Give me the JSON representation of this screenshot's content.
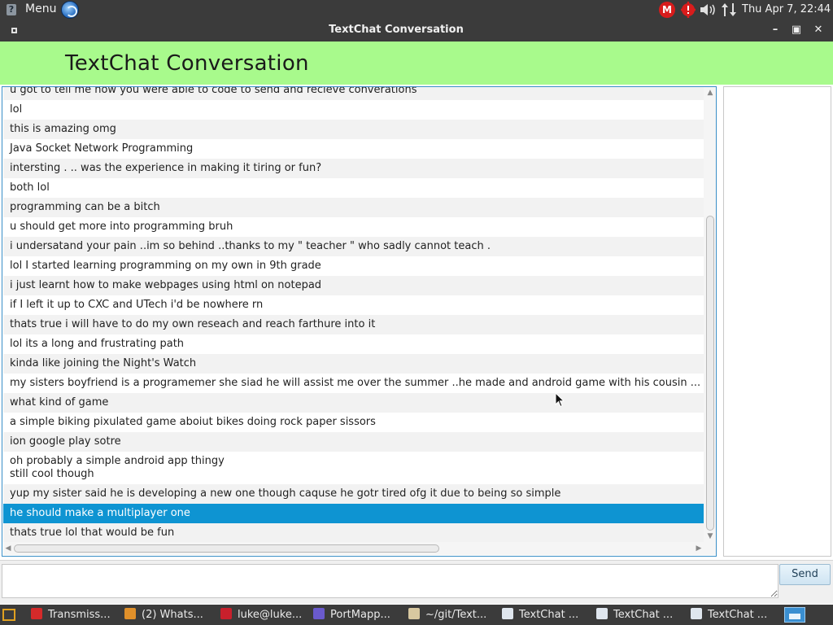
{
  "top_panel": {
    "menu_label": "Menu",
    "gmail_badge": "M",
    "clock": "Thu Apr  7, 22:44"
  },
  "window": {
    "title": "TextChat Conversation",
    "minimize_glyph": "–",
    "maximize_glyph": "▣",
    "close_glyph": "✕"
  },
  "app": {
    "header_title": "TextChat Conversation",
    "accent_color": "#a8fa8c",
    "selection_color": "#0e94d2"
  },
  "messages": [
    {
      "lines": [
        "u got to tell me how you were able to code to send and recieve converations"
      ]
    },
    {
      "lines": [
        "lol"
      ]
    },
    {
      "lines": [
        "this is amazing omg"
      ]
    },
    {
      "lines": [
        "Java Socket Network Programming"
      ]
    },
    {
      "lines": [
        "intersting . ..  was the experience in making it  tiring or fun?"
      ]
    },
    {
      "lines": [
        "both lol"
      ]
    },
    {
      "lines": [
        "programming can be a bitch"
      ]
    },
    {
      "lines": [
        "u should get more into programming bruh"
      ]
    },
    {
      "lines": [
        "i undersatand your pain ..im so behind ..thanks to my \" teacher \" who sadly cannot teach ."
      ]
    },
    {
      "lines": [
        "lol I started learning programming on my own in 9th grade"
      ]
    },
    {
      "lines": [
        "i just learnt how to make webpages  using html on notepad"
      ]
    },
    {
      "lines": [
        "if I left it up to CXC and UTech i'd be nowhere rn"
      ]
    },
    {
      "lines": [
        "thats true i will have to do my own reseach and reach farthure into it"
      ]
    },
    {
      "lines": [
        "lol its a long and frustrating path"
      ]
    },
    {
      "lines": [
        "kinda like joining the Night's Watch"
      ]
    },
    {
      "lines": [
        "my sisters boyfriend is a programemer she siad he will assist me over the summer  ..he made and android game  with his cousin  ..."
      ]
    },
    {
      "lines": [
        "what kind of game"
      ]
    },
    {
      "lines": [
        "a simple biking pixulated game  aboiut bikes doing rock paper sissors"
      ]
    },
    {
      "lines": [
        "ion google play sotre"
      ]
    },
    {
      "lines": [
        "oh probably a simple android app thingy",
        "still cool though"
      ]
    },
    {
      "lines": [
        "yup my sister said he is developing a new one though caquse he gotr tired ofg it due to being so simple"
      ]
    },
    {
      "lines": [
        "he should make a multiplayer one"
      ],
      "selected": true
    },
    {
      "lines": [
        "thats true lol that would be fun"
      ]
    }
  ],
  "composer": {
    "input_value": "",
    "send_label": "Send"
  },
  "taskbar": {
    "tasks": [
      {
        "label": "Transmiss...",
        "icon": "transmission-icon",
        "color": "#d42a2a"
      },
      {
        "label": "(2) Whats...",
        "icon": "browser-icon",
        "color": "#e0902a"
      },
      {
        "label": "luke@luke...",
        "icon": "terminal-icon",
        "color": "#c8202c"
      },
      {
        "label": "PortMapp...",
        "icon": "portmapper-icon",
        "color": "#6a5acd"
      },
      {
        "label": "~/git/Text...",
        "icon": "file-manager-icon",
        "color": "#d8c8a0"
      },
      {
        "label": "TextChat ...",
        "icon": "window-icon",
        "color": "#dfe6ee"
      },
      {
        "label": "TextChat ...",
        "icon": "window-icon",
        "color": "#dfe6ee"
      },
      {
        "label": "TextChat ...",
        "icon": "window-icon",
        "color": "#dfe6ee"
      }
    ]
  }
}
